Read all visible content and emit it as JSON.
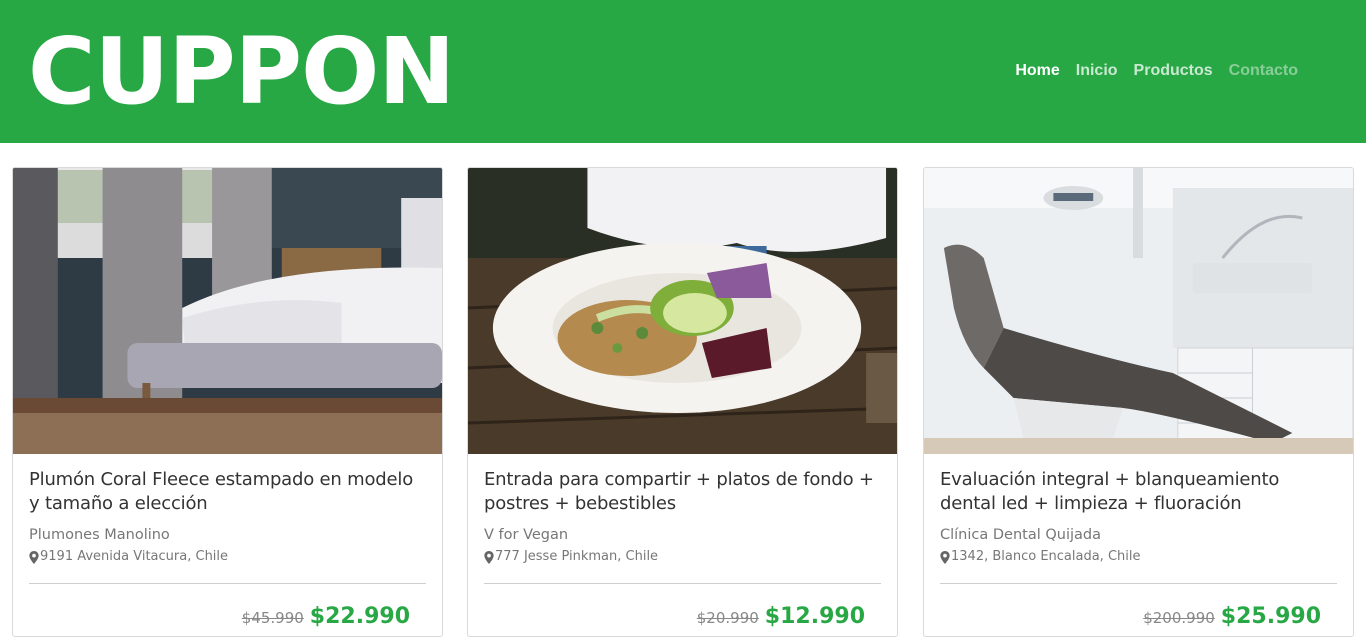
{
  "brand": {
    "logo": "CUPPON",
    "primary_color": "#28a745"
  },
  "nav": {
    "items": [
      {
        "label": "Home",
        "state": "active"
      },
      {
        "label": "Inicio",
        "state": "normal"
      },
      {
        "label": "Productos",
        "state": "normal"
      },
      {
        "label": "Contacto",
        "state": "muted"
      }
    ]
  },
  "cards": [
    {
      "image": "bedroom-photo",
      "title": "Plumón Coral Fleece estampado en modelo y tamaño a elección",
      "vendor": "Plumones Manolino",
      "location_icon": "map-marker-icon",
      "location": "9191 Avenida Vitacura, Chile",
      "old_price": "$45.990",
      "new_price": "$22.990"
    },
    {
      "image": "vegan-dish-photo",
      "title": "Entrada para compartir + platos de fondo + postres + bebestibles",
      "vendor": "V for Vegan",
      "location_icon": "map-marker-icon",
      "location": "777 Jesse Pinkman, Chile",
      "old_price": "$20.990",
      "new_price": "$12.990"
    },
    {
      "image": "dental-chair-photo",
      "title": "Evaluación integral + blanqueamiento dental led + limpieza + fluoración",
      "vendor": "Clínica Dental Quijada",
      "location_icon": "map-marker-icon",
      "location": "1342, Blanco Encalada, Chile",
      "old_price": "$200.990",
      "new_price": "$25.990"
    }
  ]
}
